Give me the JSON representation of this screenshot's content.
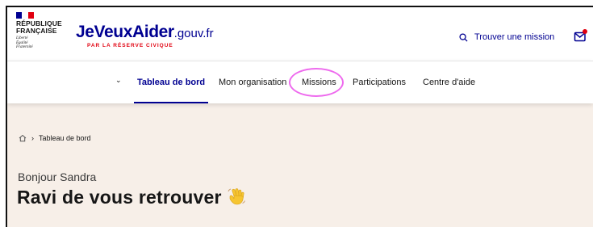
{
  "gov": {
    "name_line1": "RÉPUBLIQUE",
    "name_line2": "FRANÇAISE",
    "motto1": "Liberté",
    "motto2": "Égalité",
    "motto3": "Fraternité"
  },
  "brand": {
    "name": "JeVeuxAider",
    "domain": ".gouv.fr",
    "tagline": "PAR LA RÉSERVE CIVIQUE"
  },
  "header": {
    "find_mission": "Trouver une mission"
  },
  "nav": {
    "items": [
      {
        "label": "Tableau de bord",
        "active": true
      },
      {
        "label": "Mon organisation",
        "active": false
      },
      {
        "label": "Missions",
        "active": false
      },
      {
        "label": "Participations",
        "active": false
      },
      {
        "label": "Centre d'aide",
        "active": false
      }
    ]
  },
  "breadcrumb": {
    "current": "Tableau de bord"
  },
  "main": {
    "greeting": "Bonjour Sandra",
    "title": "Ravi de vous retrouver"
  },
  "colors": {
    "primary": "#000091",
    "accent": "#e1000f",
    "background": "#f7efe8",
    "highlight": "#ee6aee"
  },
  "icons": [
    "search-icon",
    "mail-icon",
    "chevron-down-icon",
    "home-icon",
    "chevron-right-icon",
    "waving-hand-icon"
  ]
}
